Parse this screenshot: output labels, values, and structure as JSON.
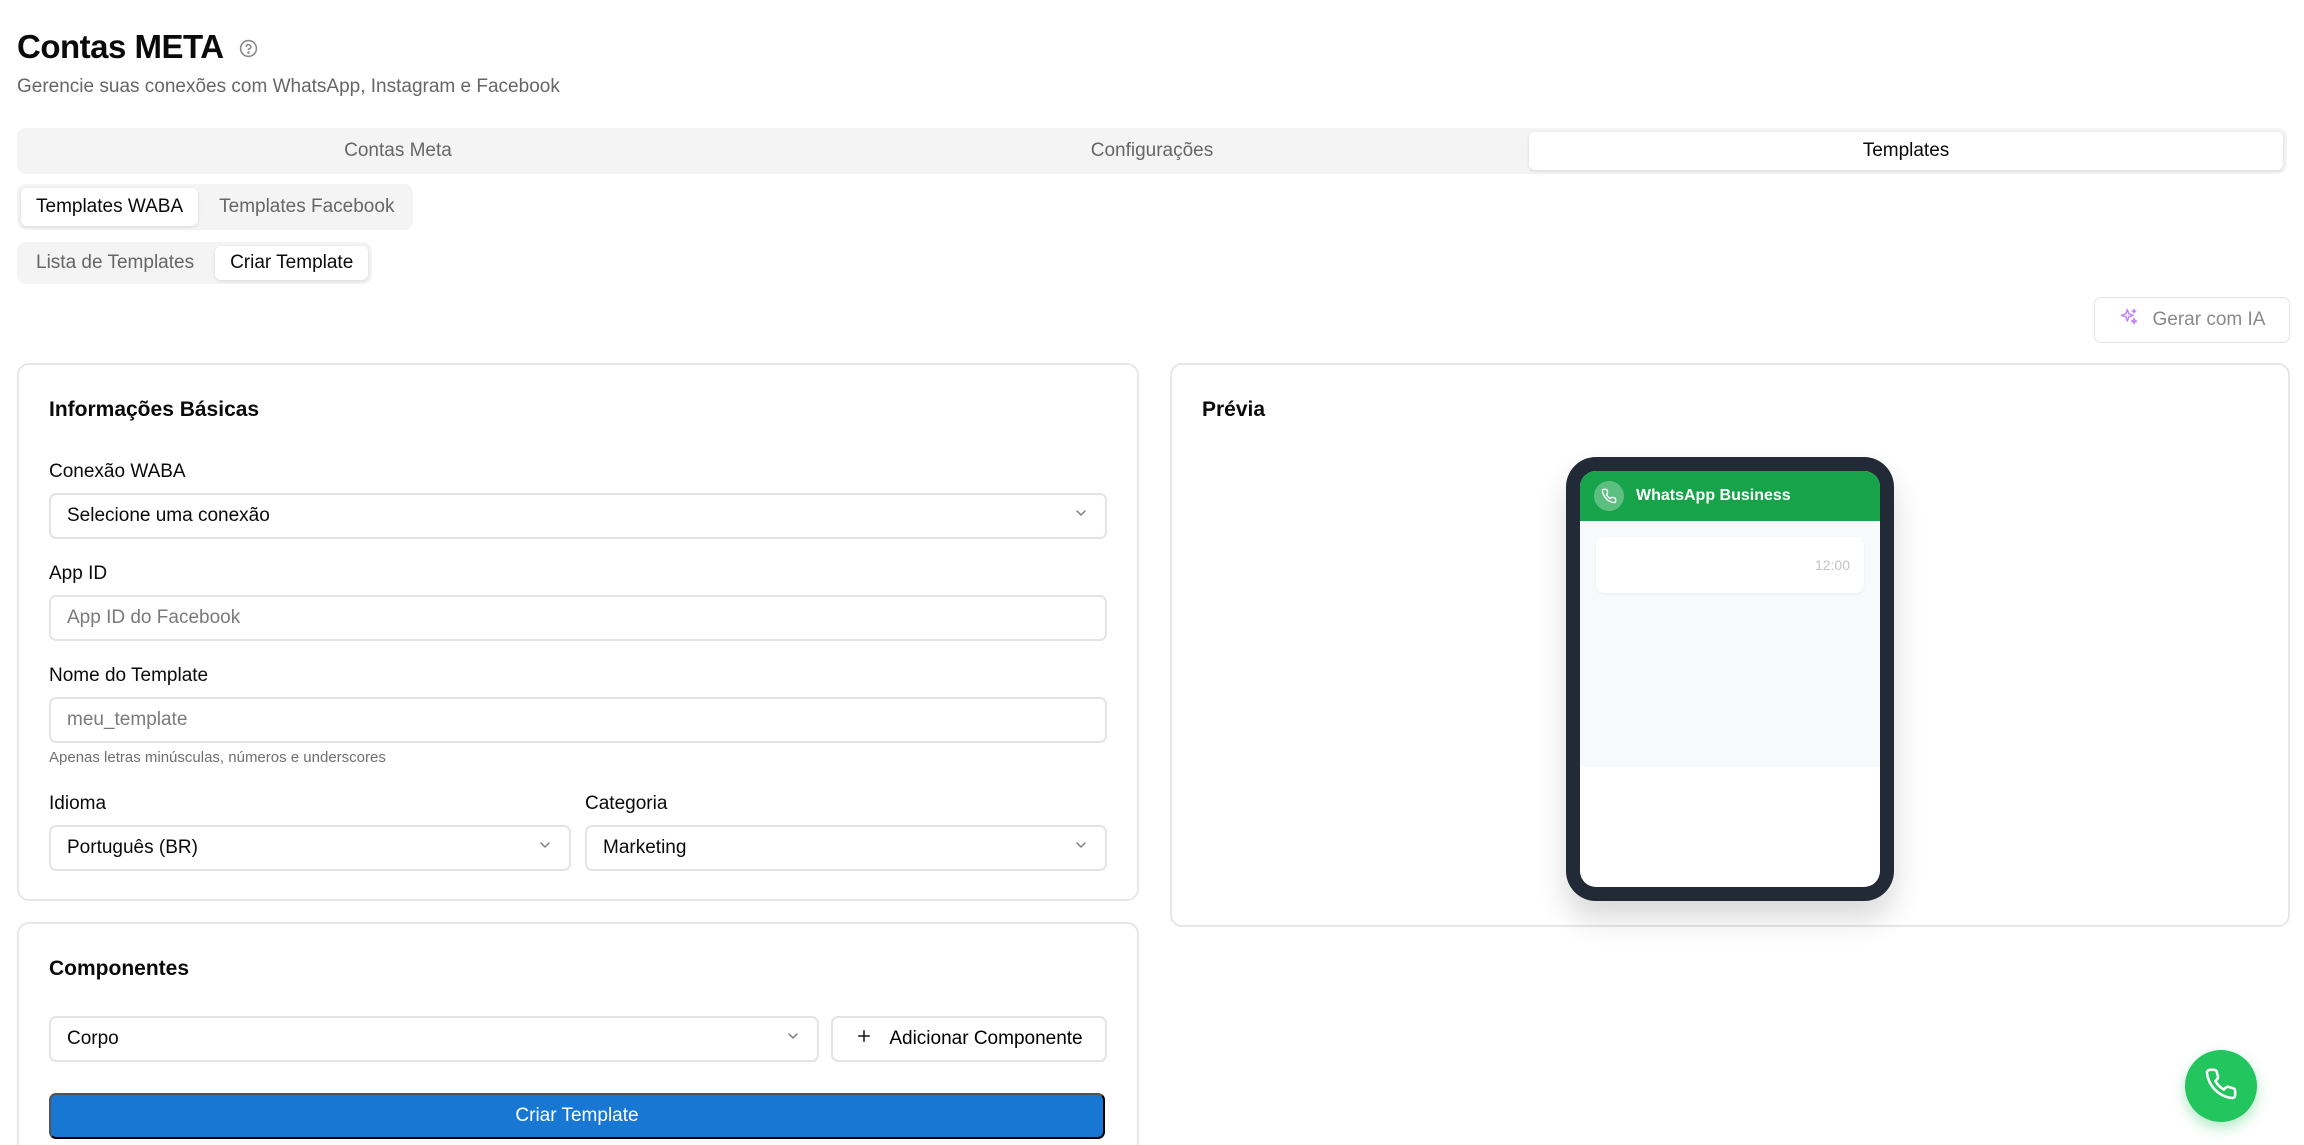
{
  "header": {
    "title": "Contas META",
    "subtitle": "Gerencie suas conexões com WhatsApp, Instagram e Facebook",
    "help_icon": "help-circle-icon"
  },
  "main_tabs": [
    {
      "label": "Contas Meta",
      "active": false
    },
    {
      "label": "Configurações",
      "active": false
    },
    {
      "label": "Templates",
      "active": true
    }
  ],
  "platform_tabs": [
    {
      "label": "Templates WABA",
      "active": true
    },
    {
      "label": "Templates Facebook",
      "active": false
    }
  ],
  "view_tabs": [
    {
      "label": "Lista de Templates",
      "active": false
    },
    {
      "label": "Criar Template",
      "active": true
    }
  ],
  "ai_button": {
    "label": "Gerar com IA",
    "icon": "sparkles-icon"
  },
  "basic_info": {
    "title": "Informações Básicas",
    "waba_connection": {
      "label": "Conexão WABA",
      "value": "Selecione uma conexão"
    },
    "app_id": {
      "label": "App ID",
      "placeholder": "App ID do Facebook"
    },
    "template_name": {
      "label": "Nome do Template",
      "placeholder": "meu_template",
      "hint": "Apenas letras minúsculas, números e underscores"
    },
    "language": {
      "label": "Idioma",
      "value": "Português (BR)"
    },
    "category": {
      "label": "Categoria",
      "value": "Marketing"
    }
  },
  "components": {
    "title": "Componentes",
    "type_select": "Corpo",
    "add_label": "Adicionar Componente",
    "submit_label": "Criar Template"
  },
  "preview": {
    "title": "Prévia",
    "app_name": "WhatsApp Business",
    "message_time": "12:00"
  },
  "colors": {
    "primary": "#1877d2",
    "whatsapp_green": "#16a34a",
    "fab_green": "#22c55e",
    "phone_frame": "#222a38"
  }
}
